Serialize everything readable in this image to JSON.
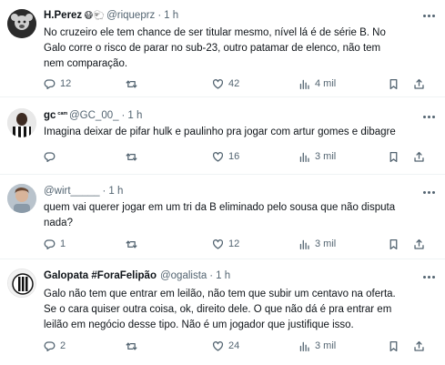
{
  "tweets": [
    {
      "name": "H.Perez",
      "badges": "😷🐑",
      "handle": "@riqueprz",
      "dot": "·",
      "time": "1 h",
      "lines": [
        "No cruzeiro ele tem chance de ser titular mesmo, nível lá é de série B. No",
        "Galo corre o risco de parar no sub-23, outro patamar de elenco, não tem",
        "nem comparação."
      ],
      "replies": "12",
      "retweets": "",
      "likes": "42",
      "views": "4 mil"
    },
    {
      "name": "gc",
      "badges": "ᶜᵃᵐ",
      "handle": "@GC_00_",
      "dot": "·",
      "time": "1 h",
      "lines": [
        "Imagina deixar de pifar hulk e paulinho pra jogar com artur gomes e dibagre"
      ],
      "replies": "",
      "retweets": "",
      "likes": "16",
      "views": "3 mil"
    },
    {
      "name": "",
      "badges": "",
      "handle": "@wirt_____",
      "dot": "·",
      "time": "1 h",
      "lines": [
        "quem vai querer jogar em um tri da B eliminado pelo sousa que não disputa",
        "nada?"
      ],
      "replies": "1",
      "retweets": "",
      "likes": "12",
      "views": "3 mil"
    },
    {
      "name": "Galopata #ForaFelipão",
      "badges": "",
      "handle": "@ogalista",
      "dot": "·",
      "time": "1 h",
      "lines": [
        "Galo não tem que entrar em leilão, não tem que subir um centavo na oferta.",
        "Se o cara quiser outra coisa, ok, direito dele. O que não dá é pra entrar em",
        "leilão em negócio desse tipo. Não é um jogador que justifique isso."
      ],
      "replies": "2",
      "retweets": "",
      "likes": "24",
      "views": "3 mil"
    }
  ],
  "icons": {
    "reply": "reply-icon",
    "retweet": "retweet-icon",
    "like": "heart-icon",
    "views": "views-chart-icon",
    "bookmark": "bookmark-icon",
    "share": "share-icon",
    "more": "more-dots-icon"
  },
  "colors": {
    "text": "#0f1419",
    "muted": "#536471",
    "separator": "#eff3f4"
  }
}
